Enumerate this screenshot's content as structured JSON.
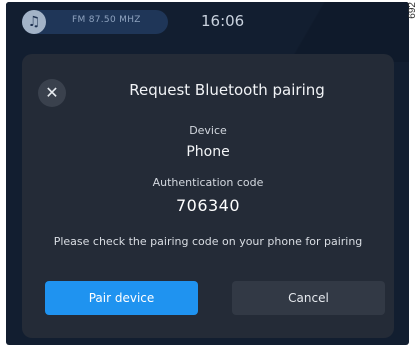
{
  "status_bar": {
    "music_icon": "music-note-icon",
    "radio_station": "FM 87.50 MHZ",
    "time": "16:06"
  },
  "dialog": {
    "close_icon": "close-icon",
    "title": "Request Bluetooth pairing",
    "device_label": "Device",
    "device_value": "Phone",
    "auth_label": "Authentication code",
    "auth_code": "706340",
    "message": "Please check the pairing code on your phone for pairing",
    "pair_button": "Pair device",
    "cancel_button": "Cancel"
  },
  "figure_ref": "692",
  "colors": {
    "background": "#121e30",
    "dialog": "#242b37",
    "primary": "#1f93f0",
    "secondary": "#323945"
  }
}
